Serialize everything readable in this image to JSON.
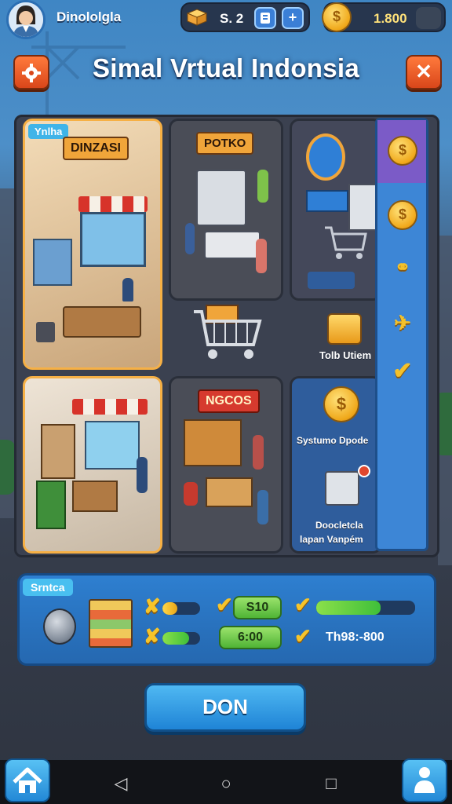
{
  "hud": {
    "player_name": "Dinololgla",
    "resource_value": "S. 2",
    "coins": "1.800",
    "add_label": "+"
  },
  "header": {
    "title": "Simal Vrtual Indonsia"
  },
  "tiles": [
    {
      "tag": "Ynlha",
      "sign": "DINZASI"
    },
    {
      "sign": "POTKO"
    },
    {
      "sign": ""
    },
    {
      "sign": ""
    },
    {
      "sign": "NGCOS"
    },
    {
      "sign": ""
    }
  ],
  "board_items": {
    "item_label": "Tolb Utiem",
    "system_label": "Systumo Dpode",
    "doc_label_1": "Doocletcla",
    "doc_label_2": "lapan Vanpém"
  },
  "stats": {
    "tag": "Srntca",
    "pill_1": "S10",
    "pill_2": "6:00",
    "stat_text": "Th98:-800",
    "bar_fill_1": 0.4,
    "bar_fill_2": 0.7,
    "bar_fill_3": 0.65
  },
  "actions": {
    "primary_label": "DON"
  },
  "icons": {
    "settings": "gear-icon",
    "close": "close-icon",
    "home": "home-icon",
    "profile": "person-icon",
    "back": "back-triangle-icon",
    "circle": "home-circle-icon",
    "square": "recents-square-icon"
  },
  "colors": {
    "accent_orange": "#d9461a",
    "primary_blue": "#2388d6",
    "coin_gold": "#f0a81a",
    "progress_green": "#3fbf3a"
  }
}
